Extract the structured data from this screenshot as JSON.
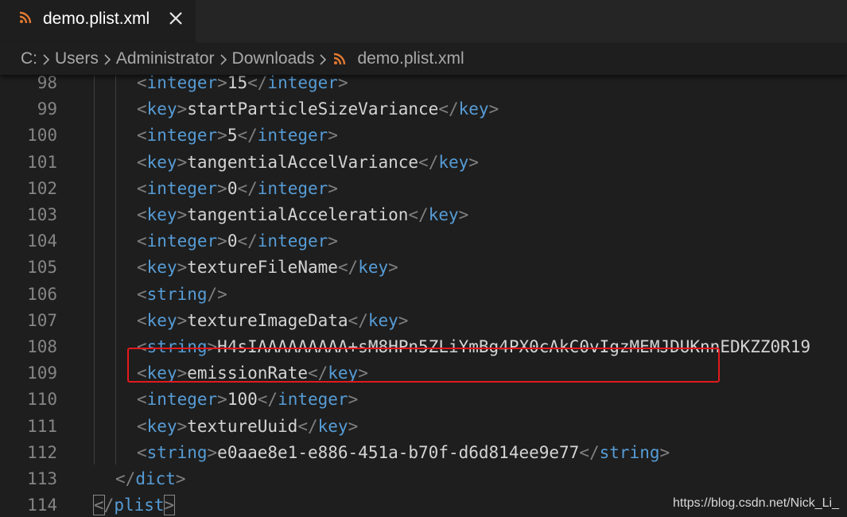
{
  "tab": {
    "title": "demo.plist.xml",
    "file_icon": "rss-icon",
    "close_icon": "close-icon"
  },
  "breadcrumb": {
    "items": [
      "C:",
      "Users",
      "Administrator",
      "Downloads",
      "demo.plist.xml"
    ]
  },
  "editor": {
    "lines": [
      {
        "num": "98",
        "tag": "integer",
        "value": "15"
      },
      {
        "num": "99",
        "tag": "key",
        "value": "startParticleSizeVariance"
      },
      {
        "num": "100",
        "tag": "integer",
        "value": "5"
      },
      {
        "num": "101",
        "tag": "key",
        "value": "tangentialAccelVariance"
      },
      {
        "num": "102",
        "tag": "integer",
        "value": "0"
      },
      {
        "num": "103",
        "tag": "key",
        "value": "tangentialAcceleration"
      },
      {
        "num": "104",
        "tag": "integer",
        "value": "0"
      },
      {
        "num": "105",
        "tag": "key",
        "value": "textureFileName"
      },
      {
        "num": "106",
        "tag": "string",
        "value": "",
        "self_closing": true
      },
      {
        "num": "107",
        "tag": "key",
        "value": "textureImageData"
      },
      {
        "num": "108",
        "tag": "string",
        "value": "H4sIAAAAAAAAA+sM8HPn5ZLiYmBg4PX0cAkC0vIgzMEMJDUKnnEDKZZ0R19",
        "truncated": true
      },
      {
        "num": "109",
        "tag": "key",
        "value": "emissionRate"
      },
      {
        "num": "110",
        "tag": "integer",
        "value": "100"
      },
      {
        "num": "111",
        "tag": "key",
        "value": "textureUuid"
      },
      {
        "num": "112",
        "tag": "string",
        "value": "e0aae8e1-e886-451a-b70f-d6d814ee9e77",
        "highlighted": true
      },
      {
        "num": "113",
        "tag": "dict",
        "close_only": true
      },
      {
        "num": "114",
        "tag": "plist",
        "close_only": true
      }
    ]
  },
  "colors": {
    "background": "#1e1e1e",
    "tag_bracket": "#808080",
    "tag_name": "#569cd6",
    "text": "#d4d4d4",
    "line_number": "#858585",
    "highlight_border": "#e2191d"
  },
  "watermark": "https://blog.csdn.net/Nick_Li_"
}
